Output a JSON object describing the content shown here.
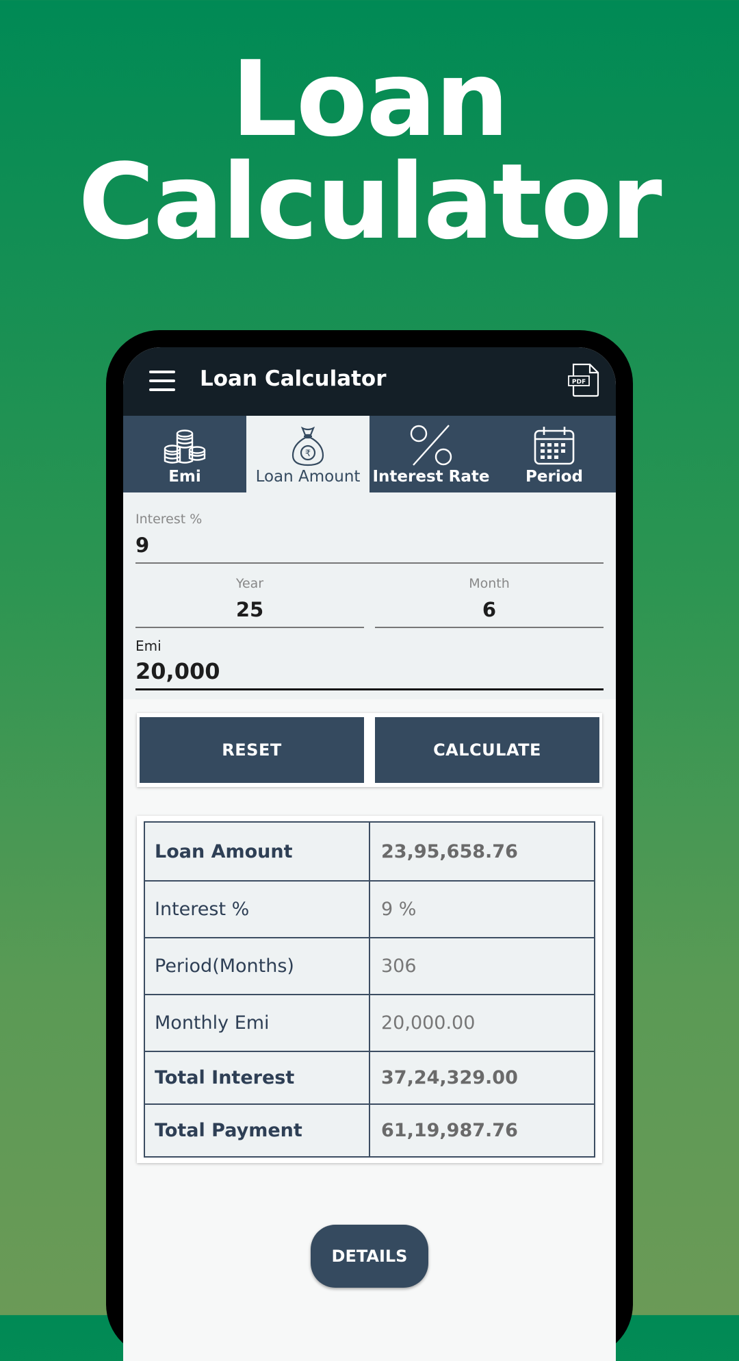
{
  "headline": {
    "line1": "Loan",
    "line2": "Calculator"
  },
  "appbar": {
    "title": "Loan Calculator",
    "pdf_label": "PDF"
  },
  "tabs": [
    {
      "label": "Emi",
      "icon": "coins-icon",
      "active": false
    },
    {
      "label": "Loan Amount",
      "icon": "money-bag-icon",
      "active": true
    },
    {
      "label": "Interest Rate",
      "icon": "percent-icon",
      "active": false
    },
    {
      "label": "Period",
      "icon": "calendar-icon",
      "active": false
    }
  ],
  "inputs": {
    "interest": {
      "label": "Interest %",
      "value": "9"
    },
    "year": {
      "label": "Year",
      "value": "25"
    },
    "month": {
      "label": "Month",
      "value": "6"
    },
    "emi": {
      "label": "Emi",
      "value": "20,000"
    }
  },
  "buttons": {
    "reset": "RESET",
    "calculate": "CALCULATE",
    "details": "DETAILS"
  },
  "results": [
    {
      "label": "Loan Amount",
      "value": "23,95,658.76"
    },
    {
      "label": "Interest %",
      "value": "9 %"
    },
    {
      "label": "Period(Months)",
      "value": "306"
    },
    {
      "label": "Monthly Emi",
      "value": "20,000.00"
    },
    {
      "label": "Total Interest",
      "value": "37,24,329.00"
    },
    {
      "label": "Total Payment",
      "value": "61,19,987.76"
    }
  ],
  "colors": {
    "primary": "#354a5f",
    "appbar": "#141f27",
    "background_top": "#008a55",
    "background_bottom": "#6b9a57"
  }
}
